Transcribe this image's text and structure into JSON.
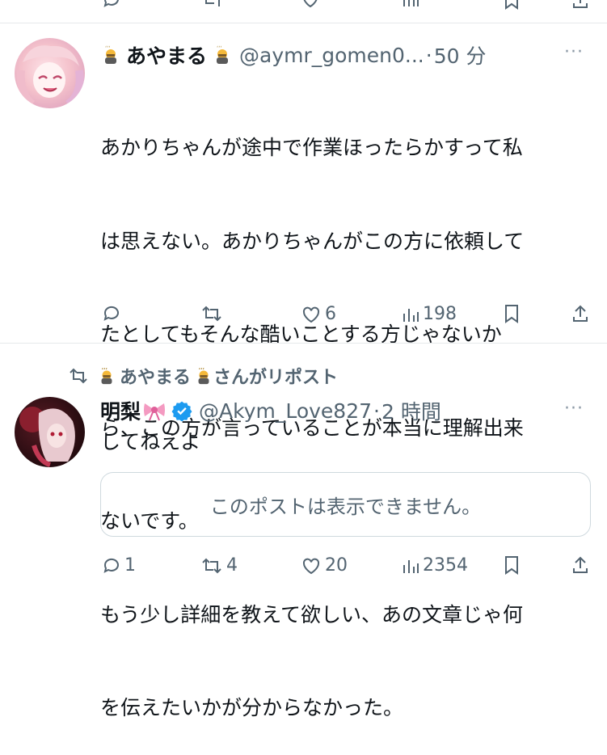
{
  "top_actions_partial": true,
  "post1": {
    "display_name": "あやまる",
    "handle": "@aymr_gomen0...",
    "separator": "·",
    "time": "50 分",
    "more": "···",
    "body_lines": [
      "あかりちゃんが途中で作業ほったらかすって私",
      "は思えない。あかりちゃんがこの方に依頼して",
      "たとしてもそんな酷いことする方じゃないか",
      "ら、この方が言っていることが本当に理解出来",
      "ないです。",
      "もう少し詳細を教えて欲しい、あの文章じゃ何",
      "を伝えたいかが分からなかった。"
    ],
    "likes": "6",
    "views": "198"
  },
  "post2": {
    "repost_label": "さんがリポスト",
    "repost_user": "あやまる",
    "display_name": "明梨",
    "verified": true,
    "handle": "@Akym_Love827",
    "separator": "·",
    "time": "2 時間",
    "more": "···",
    "body": "してねえよ",
    "quote_unavailable": "このポストは表示できません。",
    "replies": "1",
    "reposts": "4",
    "likes": "20",
    "views": "2354"
  },
  "colors": {
    "text": "#0f1419",
    "secondary": "#536471",
    "verified": "#1d9bf0",
    "divider": "#e6e9eb"
  }
}
